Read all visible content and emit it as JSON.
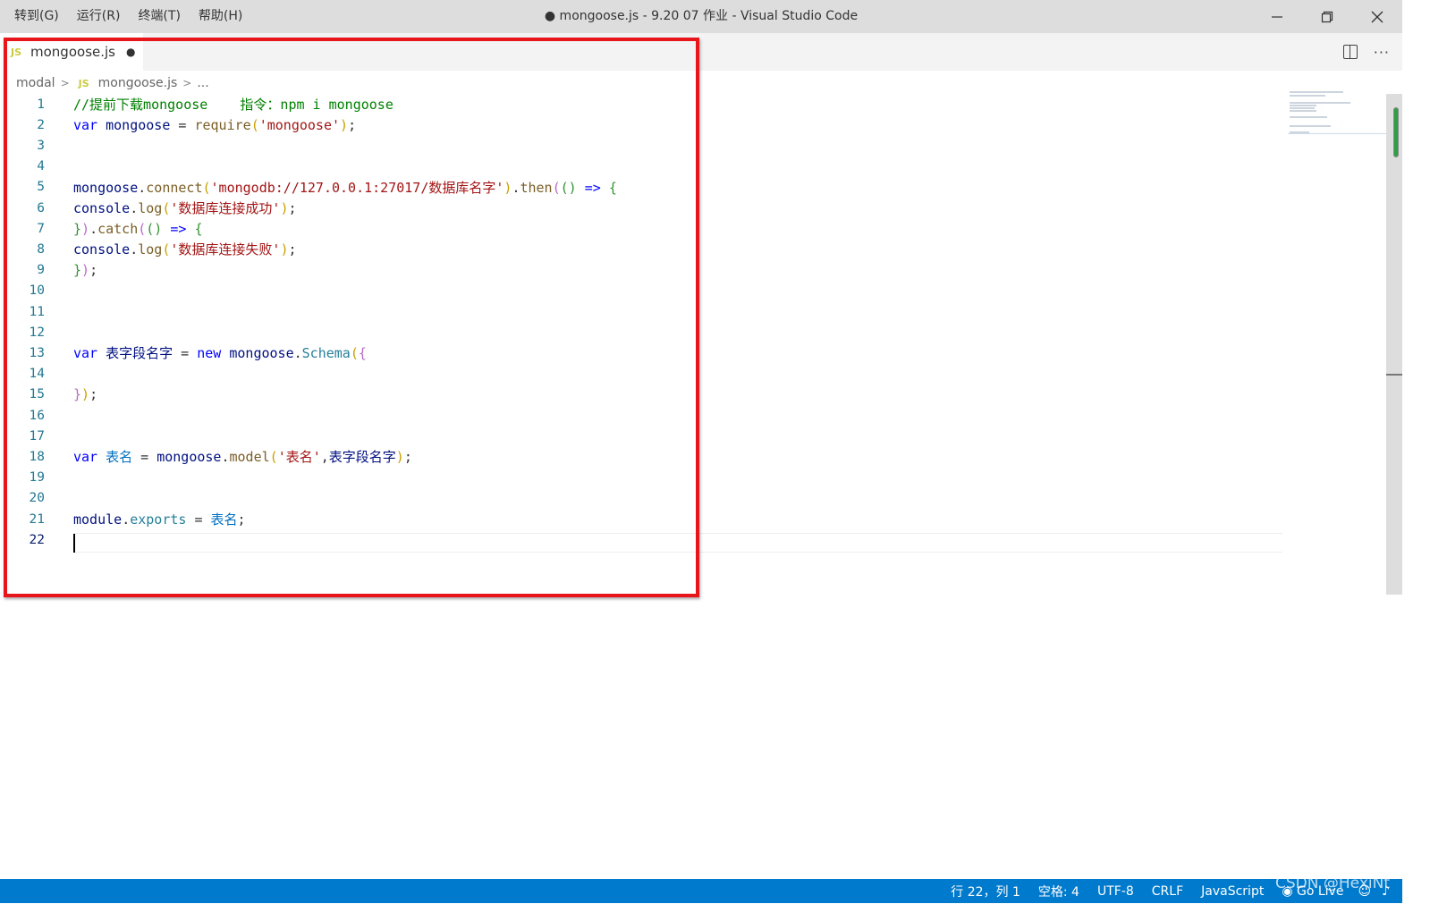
{
  "titlebar": {
    "menu": [
      "转到(G)",
      "运行(R)",
      "终端(T)",
      "帮助(H)"
    ],
    "title": "● mongoose.js - 9.20 07 作业 - Visual Studio Code",
    "minimize_icon": "minimize-icon",
    "restore_icon": "restore-icon",
    "close_icon": "close-icon"
  },
  "tab": {
    "badge": "JS",
    "label": "mongoose.js",
    "dirty_dot": "●"
  },
  "breadcrumb": {
    "folder": "modal",
    "badge": "JS",
    "file": "mongoose.js",
    "more": "..."
  },
  "editor": {
    "line_numbers": [
      "1",
      "2",
      "3",
      "4",
      "5",
      "6",
      "7",
      "8",
      "9",
      "10",
      "11",
      "12",
      "13",
      "14",
      "15",
      "16",
      "17",
      "18",
      "19",
      "20",
      "21",
      "22"
    ],
    "active_line": 22
  },
  "code": {
    "l1": "//提前下载mongoose    指令：npm i mongoose",
    "l2": {
      "kw": "var",
      "id": "mongoose",
      "eq": " = ",
      "fn": "require",
      "open": "(",
      "str": "'mongoose'",
      "close": ")",
      "semi": ";"
    },
    "l5": {
      "obj": "mongoose",
      "dot": ".",
      "fn": "connect",
      "open": "(",
      "str": "'mongodb://127.0.0.1:27017/数据库名字'",
      "close": ")",
      "dot2": ".",
      "fn2": "then",
      "open2": "(",
      "args": "()",
      "arrow": " => ",
      "brace": "{"
    },
    "l6": {
      "obj": "console",
      "dot": ".",
      "fn": "log",
      "open": "(",
      "str": "'数据库连接成功'",
      "close": ")",
      "semi": ";"
    },
    "l7": {
      "brace": "}",
      "close": ")",
      "dot": ".",
      "fn": "catch",
      "open": "(",
      "args": "()",
      "arrow": " => ",
      "brace2": "{"
    },
    "l8": {
      "obj": "console",
      "dot": ".",
      "fn": "log",
      "open": "(",
      "str": "'数据库连接失败'",
      "close": ")",
      "semi": ";"
    },
    "l9": {
      "brace": "}",
      "close": ")",
      "semi": ";"
    },
    "l13": {
      "kw": "var",
      "id": " 表字段名字",
      "eq": " = ",
      "kw2": "new",
      "obj": " mongoose",
      "dot": ".",
      "cls": "Schema",
      "open": "(",
      "brace": "{"
    },
    "l15": {
      "brace": "}",
      "close": ")",
      "semi": ";"
    },
    "l18": {
      "kw": "var",
      "id": " 表名",
      "eq": " = ",
      "obj": "mongoose",
      "dot": ".",
      "fn": "model",
      "open": "(",
      "str": "'表名'",
      "comma": ",",
      "arg": "表字段名字",
      "close": ")",
      "semi": ";"
    },
    "l21": {
      "obj": "module",
      "dot": ".",
      "prop": "exports",
      "eq": " = ",
      "id": "表名",
      "semi": ";"
    }
  },
  "statusbar": {
    "position": "行 22，列 1",
    "indent": "空格: 4",
    "encoding": "UTF-8",
    "eol": "CRLF",
    "language": "JavaScript",
    "golive": "Go Live",
    "watermark": "CSDN @HexiNt"
  },
  "colors": {
    "highlight_border": "#e8151b",
    "statusbar": "#007acc",
    "comment": "#008000",
    "keyword": "#0000ff",
    "string": "#a31515"
  }
}
